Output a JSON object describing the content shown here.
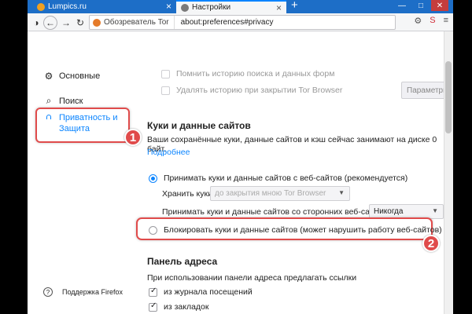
{
  "tabs": [
    {
      "title": "Lumpics.ru",
      "favicon_color": "#f0a020"
    },
    {
      "title": "Настройки",
      "favicon_color": "#7a7a7a"
    }
  ],
  "toolbar": {
    "identity_label": "Обозреватель Tor",
    "url": "about:preferences#privacy"
  },
  "sidebar": {
    "items": [
      {
        "label": "Основные",
        "icon": "gear-icon"
      },
      {
        "label": "Поиск",
        "icon": "search-icon"
      },
      {
        "label": "Приватность и\nЗащита",
        "icon": "lock-icon"
      }
    ],
    "support_label": "Поддержка Firefox"
  },
  "history": {
    "remember_search": "Помнить историю поиска и данных форм",
    "clear_on_close": "Удалять историю при закрытии Tor Browser",
    "params_button": "Параметры"
  },
  "cookies": {
    "heading": "Куки и данные сайтов",
    "description": "Ваши сохранённые куки, данные сайтов и кэш сейчас занимают на диске 0 байт.",
    "more_link": "Подробнее",
    "accept_label": "Принимать куки и данные сайтов с веб-сайтов (рекомендуется)",
    "keep_label": "Хранить куки",
    "keep_value": "до закрытия мною Tor Browser",
    "third_party_label": "Принимать куки и данные сайтов со сторонних веб-сайтов",
    "third_party_value": "Никогда",
    "block_label": "Блокировать куки и данные сайтов (может нарушить работу веб-сайтов)"
  },
  "address_bar": {
    "heading": "Панель адреса",
    "description": "При использовании панели адреса предлагать ссылки",
    "history_option": "из журнала посещений",
    "bookmarks_option": "из закладок"
  },
  "badges": [
    "1",
    "2"
  ],
  "colors": {
    "accent": "#0a84ff",
    "highlight": "#e04b4b",
    "tabstrip": "#1d6ec7"
  }
}
